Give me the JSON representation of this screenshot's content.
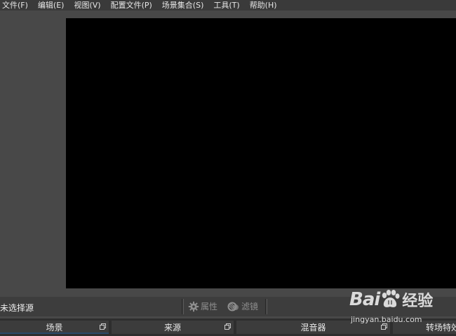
{
  "menu": [
    {
      "id": "file",
      "label": "文件(F)"
    },
    {
      "id": "edit",
      "label": "编辑(E)"
    },
    {
      "id": "view",
      "label": "视图(V)"
    },
    {
      "id": "profile",
      "label": "配置文件(P)"
    },
    {
      "id": "scene-collection",
      "label": "场景集合(S)"
    },
    {
      "id": "tools",
      "label": "工具(T)"
    },
    {
      "id": "help",
      "label": "帮助(H)"
    }
  ],
  "source_toolbar": {
    "no_source": "未选择源",
    "properties": "属性",
    "filters": "滤镜",
    "properties_icon": "gear-icon",
    "filters_icon": "filter-icon"
  },
  "docks": {
    "scenes": "场景",
    "sources": "来源",
    "mixer": "混音器",
    "transitions": "转场特效"
  },
  "watermark": {
    "logo_bai": "Bai",
    "logo_du": "du",
    "logo_jingyan": "经验",
    "url": "jingyan.baidu.com"
  },
  "colors": {
    "background": "#484848",
    "preview": "#000000",
    "menubar": "#3a3a3a"
  }
}
